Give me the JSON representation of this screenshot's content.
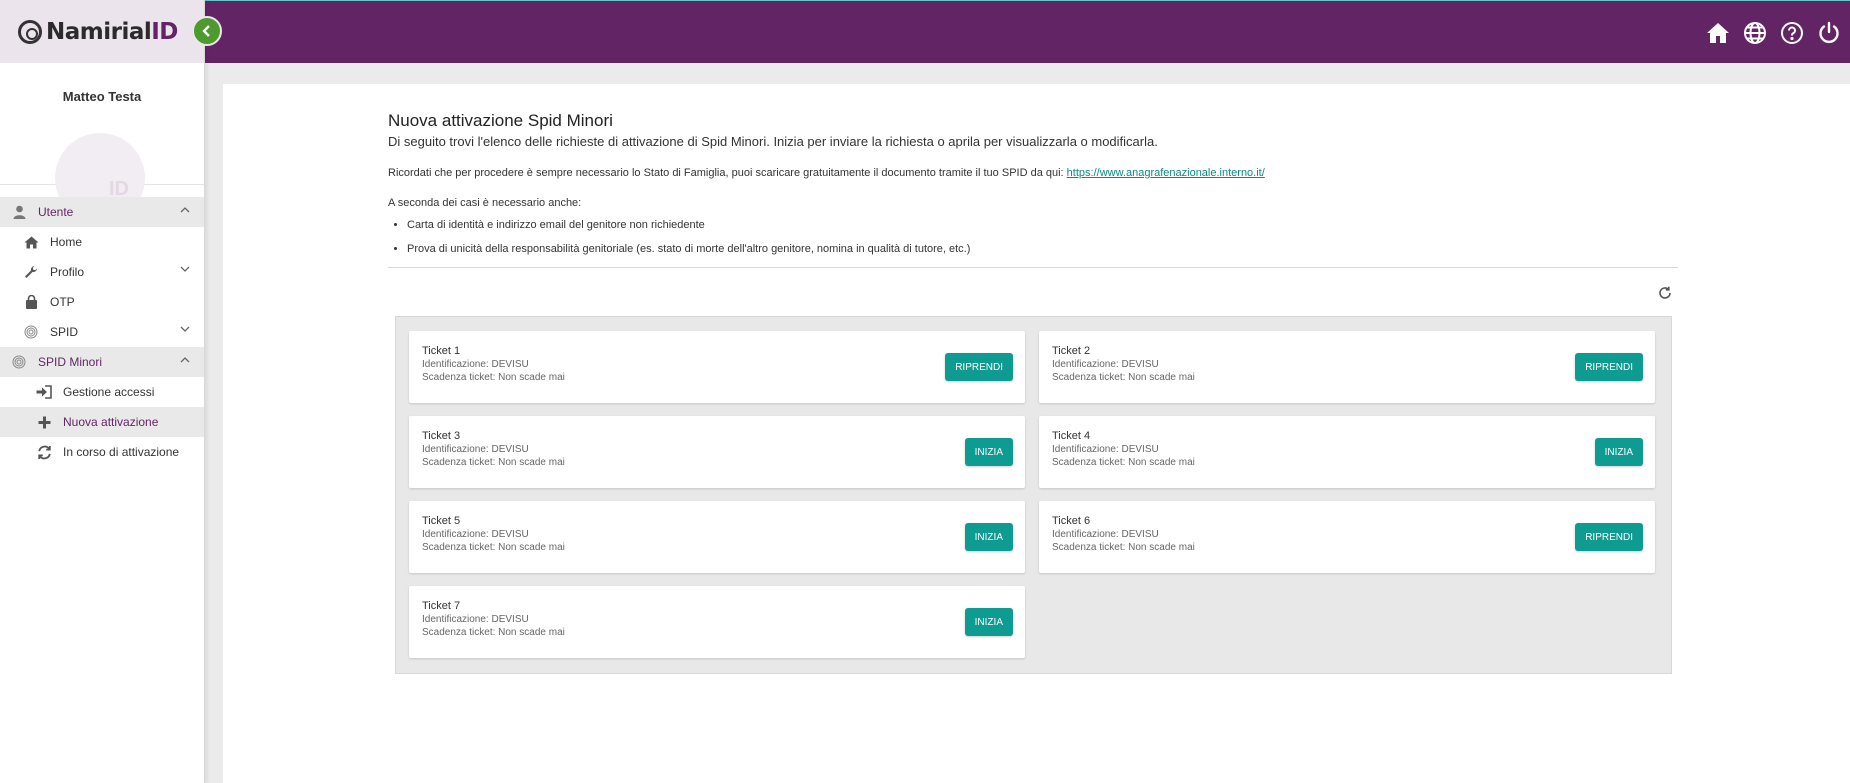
{
  "brand": {
    "name": "Namirial",
    "id_part": "ID"
  },
  "user": {
    "name": "Matteo Testa"
  },
  "sidebar": {
    "items": [
      {
        "label": "Utente",
        "icon": "user-icon",
        "type": "group",
        "chevron": "up"
      },
      {
        "label": "Home",
        "icon": "home-icon",
        "type": "lvl1"
      },
      {
        "label": "Profilo",
        "icon": "wrench-icon",
        "type": "lvl1",
        "chevron": "down"
      },
      {
        "label": "OTP",
        "icon": "otp-icon",
        "type": "lvl1"
      },
      {
        "label": "SPID",
        "icon": "fingerprint-icon",
        "type": "lvl1",
        "chevron": "down"
      },
      {
        "label": "SPID Minori",
        "icon": "fingerprint-icon",
        "type": "group",
        "chevron": "up"
      },
      {
        "label": "Gestione accessi",
        "icon": "sign-in-icon",
        "type": "lvl2"
      },
      {
        "label": "Nuova attivazione",
        "icon": "plus-icon",
        "type": "lvl2",
        "active": true
      },
      {
        "label": "In corso di attivazione",
        "icon": "refresh-icon",
        "type": "lvl2"
      }
    ]
  },
  "topbar": {
    "icons": [
      "home-icon",
      "globe-icon",
      "help-icon",
      "power-icon"
    ]
  },
  "page": {
    "title": "Nuova attivazione Spid Minori",
    "subtitle": "Di seguito trovi l'elenco delle richieste di attivazione di Spid Minori. Inizia per inviare la richiesta o aprila per visualizzarla o modificarla.",
    "note": "Ricordati che per procedere è sempre necessario lo Stato di Famiglia, puoi scaricare gratuitamente il documento tramite il tuo SPID da qui: ",
    "note_link": "https://www.anagrafenazionale.interno.it/",
    "cases_intro": "A seconda dei casi è necessario anche:",
    "bullets": [
      "Carta di identità e indirizzo email del genitore non richiedente",
      "Prova di unicità della responsabilità genitoriale (es. stato di morte dell'altro genitore, nomina in qualità di tutore, etc.)"
    ]
  },
  "tickets": [
    {
      "name": "Ticket 1",
      "identification": "Identificazione: DEVISU",
      "expiry": "Scadenza ticket: Non scade mai",
      "action": "RIPRENDI"
    },
    {
      "name": "Ticket 2",
      "identification": "Identificazione: DEVISU",
      "expiry": "Scadenza ticket: Non scade mai",
      "action": "RIPRENDI"
    },
    {
      "name": "Ticket 3",
      "identification": "Identificazione: DEVISU",
      "expiry": "Scadenza ticket: Non scade mai",
      "action": "INIZIA"
    },
    {
      "name": "Ticket 4",
      "identification": "Identificazione: DEVISU",
      "expiry": "Scadenza ticket: Non scade mai",
      "action": "INIZIA"
    },
    {
      "name": "Ticket 5",
      "identification": "Identificazione: DEVISU",
      "expiry": "Scadenza ticket: Non scade mai",
      "action": "INIZIA"
    },
    {
      "name": "Ticket 6",
      "identification": "Identificazione: DEVISU",
      "expiry": "Scadenza ticket: Non scade mai",
      "action": "RIPRENDI"
    },
    {
      "name": "Ticket 7",
      "identification": "Identificazione: DEVISU",
      "expiry": "Scadenza ticket: Non scade mai",
      "action": "INIZIA"
    }
  ],
  "colors": {
    "brand": "#632466",
    "accent": "#0d9b92",
    "collapse": "#4e9a2e"
  }
}
